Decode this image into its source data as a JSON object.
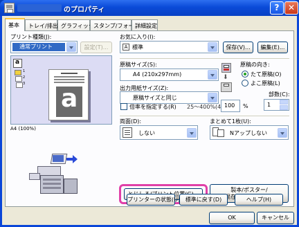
{
  "window": {
    "title": "のプロパティ",
    "help_label": "?",
    "close_label": "✕"
  },
  "tabs": [
    {
      "label": "基本",
      "active": true
    },
    {
      "label": "トレイ/排出",
      "active": false
    },
    {
      "label": "グラフィックス",
      "active": false
    },
    {
      "label": "スタンプ/フォーム",
      "active": false
    },
    {
      "label": "詳細設定",
      "active": false
    }
  ],
  "print_type": {
    "label": "プリント種類(J):",
    "value": "通常プリント",
    "settings_button": "設定(T)..."
  },
  "favorites": {
    "label": "お気に入り(I):",
    "value": "標準",
    "save_button": "保存(V)...",
    "edit_button": "編集(E)..."
  },
  "preview": {
    "sheet_letter": "a",
    "stack_numbers": [
      "1",
      "2",
      "3"
    ],
    "zoom_label": "A4 (100%)"
  },
  "paper_size": {
    "label": "原稿サイズ(S):",
    "value": "A4 (210x297mm)"
  },
  "output_size": {
    "label": "出力用紙サイズ(Z):",
    "value": "原稿サイズと同じ"
  },
  "scale": {
    "checkbox_label": "倍率を指定する(R)",
    "range_label": "25～400%(4):",
    "value": "100",
    "unit": "%"
  },
  "orientation": {
    "label": "原稿の向き:",
    "options": [
      {
        "label": "たて原稿(O)",
        "selected": true
      },
      {
        "label": "よこ原稿(L)",
        "selected": false
      }
    ]
  },
  "copies": {
    "label": "部数(C):",
    "value": "1"
  },
  "duplex": {
    "label": "両面(D):",
    "value": "しない"
  },
  "nup": {
    "label": "まとめて1枚(U):",
    "value": "Nアップしない"
  },
  "buttons": {
    "binding_position": "とじしろ/プリント位置(G)...",
    "booklet": "製本/ポスター/\n混在原稿/回転(K)...",
    "printer_status": "プリンターの状態(U)",
    "restore_defaults": "標準に戻す(D)",
    "help": "ヘルプ(H)",
    "ok": "OK",
    "cancel": "キャンセル"
  }
}
